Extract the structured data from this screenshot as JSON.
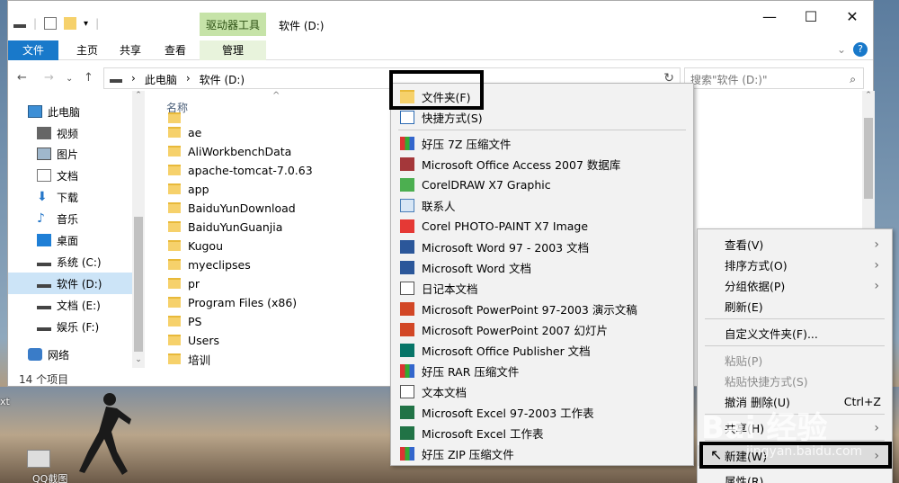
{
  "window": {
    "title": "软件 (D:)",
    "context_tab_head": "驱动器工具",
    "caption": {
      "minimize": "—",
      "maximize": "☐",
      "close": "✕"
    }
  },
  "ribbon": {
    "tabs": [
      {
        "label": "文件"
      },
      {
        "label": "主页"
      },
      {
        "label": "共享"
      },
      {
        "label": "查看"
      },
      {
        "label": "管理"
      }
    ],
    "help": "?"
  },
  "address": {
    "crumbs": [
      "此电脑",
      "软件 (D:)"
    ],
    "search_placeholder": "搜索\"软件 (D:)\""
  },
  "nav": {
    "items": [
      {
        "label": "此电脑",
        "icon": "computer-icon"
      },
      {
        "label": "视频",
        "icon": "video-icon"
      },
      {
        "label": "图片",
        "icon": "pictures-icon"
      },
      {
        "label": "文档",
        "icon": "documents-icon"
      },
      {
        "label": "下载",
        "icon": "download-icon"
      },
      {
        "label": "音乐",
        "icon": "music-icon"
      },
      {
        "label": "桌面",
        "icon": "desktop-icon"
      },
      {
        "label": "系统 (C:)",
        "icon": "drive-icon"
      },
      {
        "label": "软件 (D:)",
        "icon": "drive-icon"
      },
      {
        "label": "文档 (E:)",
        "icon": "drive-icon"
      },
      {
        "label": "娱乐 (F:)",
        "icon": "drive-icon"
      },
      {
        "label": "网络",
        "icon": "network-icon"
      }
    ]
  },
  "files": {
    "column_name": "名称",
    "items": [
      "ae",
      "AliWorkbenchData",
      "apache-tomcat-7.0.63",
      "app",
      "BaiduYunDownload",
      "BaiduYunGuanjia",
      "Kugou",
      "myeclipses",
      "pr",
      "Program Files (x86)",
      "PS",
      "Users",
      "培训"
    ],
    "status": "14 个项目"
  },
  "new_menu": {
    "items": [
      {
        "label": "文件夹(F)",
        "icon": "folder-icon"
      },
      {
        "label": "快捷方式(S)",
        "icon": "shortcut-icon"
      },
      {
        "label": "好压 7Z 压缩文件",
        "icon": "archive-icon"
      },
      {
        "label": "Microsoft Office Access 2007 数据库",
        "icon": "access-icon"
      },
      {
        "label": "CorelDRAW X7 Graphic",
        "icon": "coreldraw-icon"
      },
      {
        "label": "联系人",
        "icon": "contact-icon"
      },
      {
        "label": "Corel PHOTO-PAINT X7 Image",
        "icon": "photopaint-icon"
      },
      {
        "label": "Microsoft Word 97 - 2003 文档",
        "icon": "word-icon"
      },
      {
        "label": "Microsoft Word 文档",
        "icon": "word-icon"
      },
      {
        "label": "日记本文档",
        "icon": "journal-icon"
      },
      {
        "label": "Microsoft PowerPoint 97-2003 演示文稿",
        "icon": "powerpoint-icon"
      },
      {
        "label": "Microsoft PowerPoint 2007 幻灯片",
        "icon": "powerpoint-icon"
      },
      {
        "label": "Microsoft Office Publisher 文档",
        "icon": "publisher-icon"
      },
      {
        "label": "好压 RAR 压缩文件",
        "icon": "archive-icon"
      },
      {
        "label": "文本文档",
        "icon": "text-icon"
      },
      {
        "label": "Microsoft Excel 97-2003 工作表",
        "icon": "excel-icon"
      },
      {
        "label": "Microsoft Excel 工作表",
        "icon": "excel-icon"
      },
      {
        "label": "好压 ZIP 压缩文件",
        "icon": "archive-icon"
      }
    ]
  },
  "context_menu": {
    "items": [
      {
        "label": "查看(V)",
        "submenu": true
      },
      {
        "label": "排序方式(O)",
        "submenu": true
      },
      {
        "label": "分组依据(P)",
        "submenu": true
      },
      {
        "label": "刷新(E)"
      },
      {
        "label": "自定义文件夹(F)..."
      },
      {
        "label": "粘贴(P)",
        "disabled": true
      },
      {
        "label": "粘贴快捷方式(S)",
        "disabled": true
      },
      {
        "label": "撤消 删除(U)",
        "shortcut": "Ctrl+Z"
      },
      {
        "label": "共享(H)",
        "submenu": true
      },
      {
        "label": "新建(W)",
        "submenu": true
      },
      {
        "label": "属性(R)"
      }
    ]
  },
  "desktop": {
    "text_left": "xt",
    "text_bottom": "QQ截图",
    "watermark": "Bai 经验",
    "watermark_url": "jingyan.baidu.com"
  }
}
